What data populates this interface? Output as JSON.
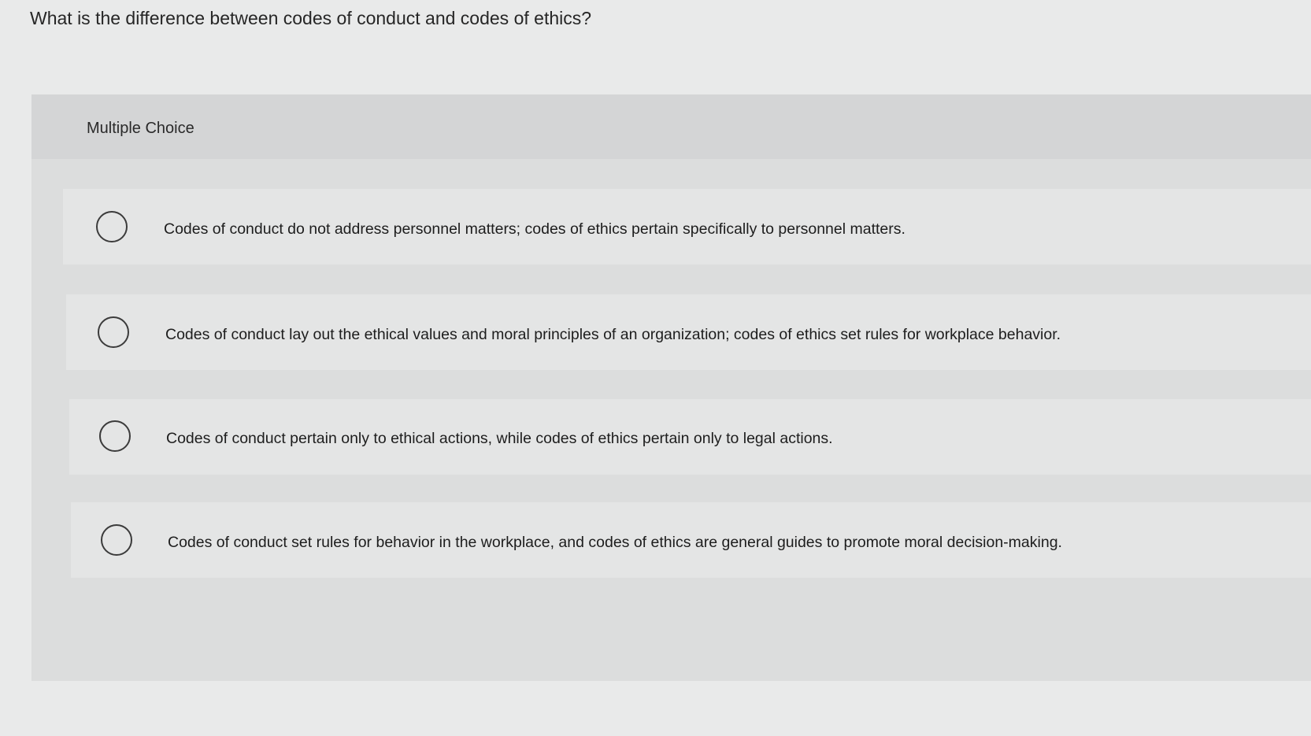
{
  "question": {
    "text": "What is the difference between codes of conduct and codes of ethics?"
  },
  "panel": {
    "label": "Multiple Choice"
  },
  "options": [
    {
      "label": "Codes of conduct do not address personnel matters; codes of ethics pertain specifically to personnel matters.",
      "selected": false
    },
    {
      "label": "Codes of conduct lay out the ethical values and moral principles of an organization; codes of ethics set rules for workplace behavior.",
      "selected": false
    },
    {
      "label": "Codes of conduct pertain only to ethical actions, while codes of ethics pertain only to legal actions.",
      "selected": false
    },
    {
      "label": "Codes of conduct set rules for behavior in the workplace, and codes of ethics are general guides to promote moral decision-making.",
      "selected": false
    }
  ]
}
